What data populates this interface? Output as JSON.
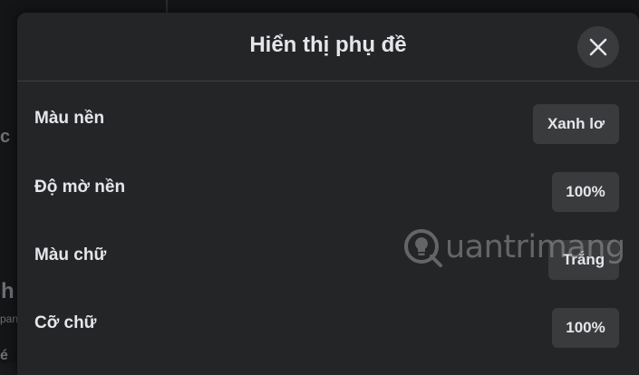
{
  "background": {
    "edge_letter_1": "c",
    "edge_letter_2": "h",
    "edge_letter_3": "pan",
    "edge_letter_4": "é"
  },
  "dialog": {
    "title": "Hiển thị phụ đề",
    "close_icon": "close-x-icon",
    "rows": [
      {
        "label": "Màu nền",
        "value": "Xanh lơ"
      },
      {
        "label": "Độ mờ nền",
        "value": "100%"
      },
      {
        "label": "Màu chữ",
        "value": "Trắng"
      },
      {
        "label": "Cỡ chữ",
        "value": "100%"
      }
    ]
  },
  "watermark": {
    "text": "uantrimang",
    "icon": "lightbulb-q-icon"
  },
  "colors": {
    "dialog_bg": "#242526",
    "button_bg": "#3a3b3c",
    "text": "#e4e6eb"
  }
}
